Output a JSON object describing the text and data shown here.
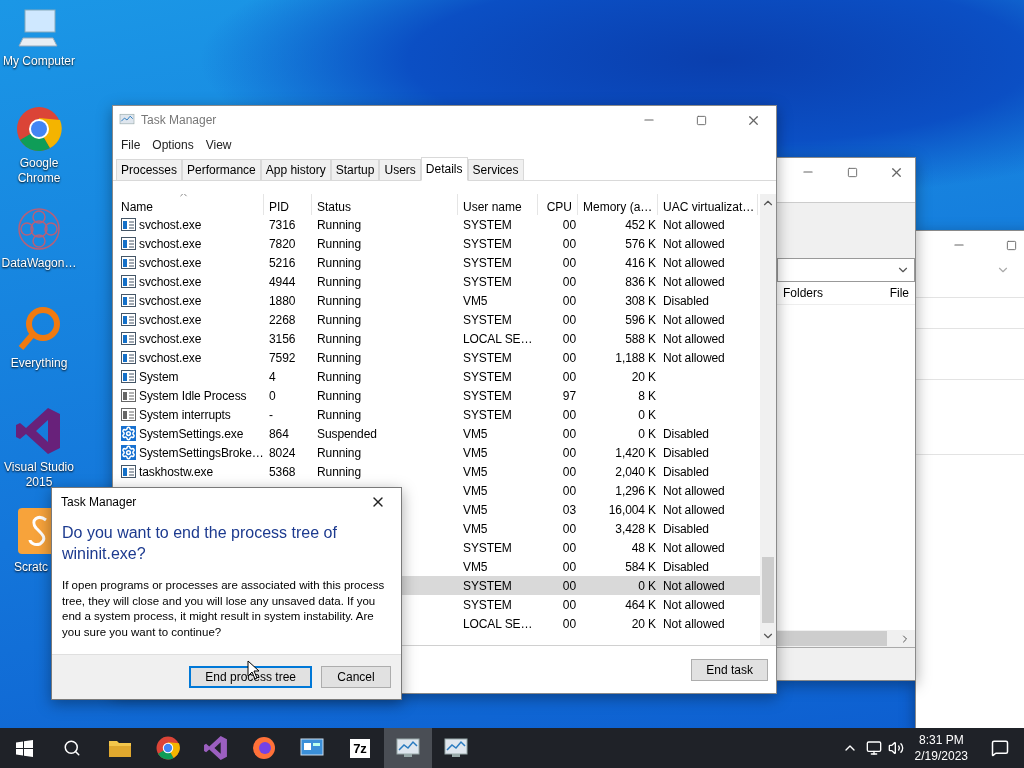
{
  "desktop_icons": [
    {
      "kind": "computer",
      "label": "My Computer"
    },
    {
      "kind": "chrome",
      "label": "Google Chrome"
    },
    {
      "kind": "wagon",
      "label": "DataWagon…"
    },
    {
      "kind": "everything",
      "label": "Everything"
    },
    {
      "kind": "vs",
      "label": "Visual Studio 2015"
    },
    {
      "kind": "scratch",
      "label": "Scratc"
    }
  ],
  "back_window_1": {
    "columns": [
      "Folders",
      "File"
    ]
  },
  "task_manager": {
    "title": "Task Manager",
    "menu": [
      "File",
      "Options",
      "View"
    ],
    "tabs": [
      {
        "label": "Processes",
        "selected": false
      },
      {
        "label": "Performance",
        "selected": false
      },
      {
        "label": "App history",
        "selected": false
      },
      {
        "label": "Startup",
        "selected": false
      },
      {
        "label": "Users",
        "selected": false
      },
      {
        "label": "Details",
        "selected": true
      },
      {
        "label": "Services",
        "selected": false
      }
    ],
    "columns": [
      "Name",
      "PID",
      "Status",
      "User name",
      "CPU",
      "Memory (a…",
      "UAC virtualizat…"
    ],
    "rows": [
      {
        "kind": "service",
        "name": "svchost.exe",
        "pid": "7316",
        "status": "Running",
        "user": "SYSTEM",
        "cpu": "00",
        "memory": "452 K",
        "uac": "Not allowed",
        "selected": false
      },
      {
        "kind": "service",
        "name": "svchost.exe",
        "pid": "7820",
        "status": "Running",
        "user": "SYSTEM",
        "cpu": "00",
        "memory": "576 K",
        "uac": "Not allowed",
        "selected": false
      },
      {
        "kind": "service",
        "name": "svchost.exe",
        "pid": "5216",
        "status": "Running",
        "user": "SYSTEM",
        "cpu": "00",
        "memory": "416 K",
        "uac": "Not allowed",
        "selected": false
      },
      {
        "kind": "service",
        "name": "svchost.exe",
        "pid": "4944",
        "status": "Running",
        "user": "SYSTEM",
        "cpu": "00",
        "memory": "836 K",
        "uac": "Not allowed",
        "selected": false
      },
      {
        "kind": "service",
        "name": "svchost.exe",
        "pid": "1880",
        "status": "Running",
        "user": "VM5",
        "cpu": "00",
        "memory": "308 K",
        "uac": "Disabled",
        "selected": false
      },
      {
        "kind": "service",
        "name": "svchost.exe",
        "pid": "2268",
        "status": "Running",
        "user": "SYSTEM",
        "cpu": "00",
        "memory": "596 K",
        "uac": "Not allowed",
        "selected": false
      },
      {
        "kind": "service",
        "name": "svchost.exe",
        "pid": "3156",
        "status": "Running",
        "user": "LOCAL SE…",
        "cpu": "00",
        "memory": "588 K",
        "uac": "Not allowed",
        "selected": false
      },
      {
        "kind": "service",
        "name": "svchost.exe",
        "pid": "7592",
        "status": "Running",
        "user": "SYSTEM",
        "cpu": "00",
        "memory": "1,188 K",
        "uac": "Not allowed",
        "selected": false
      },
      {
        "kind": "service",
        "name": "System",
        "pid": "4",
        "status": "Running",
        "user": "SYSTEM",
        "cpu": "00",
        "memory": "20 K",
        "selected": false
      },
      {
        "kind": "system",
        "name": "System Idle Process",
        "pid": "0",
        "status": "Running",
        "user": "SYSTEM",
        "cpu": "97",
        "memory": "8 K",
        "selected": false
      },
      {
        "kind": "system",
        "name": "System interrupts",
        "pid": "-",
        "status": "Running",
        "user": "SYSTEM",
        "cpu": "00",
        "memory": "0 K",
        "selected": false
      },
      {
        "kind": "gear",
        "name": "SystemSettings.exe",
        "pid": "864",
        "status": "Suspended",
        "user": "VM5",
        "cpu": "00",
        "memory": "0 K",
        "uac": "Disabled",
        "selected": false
      },
      {
        "kind": "gear",
        "name": "SystemSettingsBroke…",
        "pid": "8024",
        "status": "Running",
        "user": "VM5",
        "cpu": "00",
        "memory": "1,420 K",
        "uac": "Disabled",
        "selected": false
      },
      {
        "kind": "service",
        "name": "taskhostw.exe",
        "pid": "5368",
        "status": "Running",
        "user": "VM5",
        "cpu": "00",
        "memory": "2,040 K",
        "uac": "Disabled",
        "selected": false
      },
      {
        "user": "VM5",
        "cpu": "00",
        "memory": "1,296 K",
        "uac": "Not allowed",
        "selected": false
      },
      {
        "user": "VM5",
        "cpu": "03",
        "memory": "16,004 K",
        "uac": "Not allowed",
        "selected": false
      },
      {
        "user": "VM5",
        "cpu": "00",
        "memory": "3,428 K",
        "uac": "Disabled",
        "selected": false
      },
      {
        "user": "SYSTEM",
        "cpu": "00",
        "memory": "48 K",
        "uac": "Not allowed",
        "selected": false
      },
      {
        "user": "VM5",
        "cpu": "00",
        "memory": "584 K",
        "uac": "Disabled",
        "selected": false
      },
      {
        "user": "SYSTEM",
        "cpu": "00",
        "memory": "0 K",
        "uac": "Not allowed",
        "selected": true
      },
      {
        "user": "SYSTEM",
        "cpu": "00",
        "memory": "464 K",
        "uac": "Not allowed",
        "selected": false
      },
      {
        "user": "LOCAL SE…",
        "cpu": "00",
        "memory": "20 K",
        "uac": "Not allowed",
        "selected": false
      }
    ],
    "end_task_button": "End task"
  },
  "dialog": {
    "title": "Task Manager",
    "heading": "Do you want to end the process tree of wininit.exe?",
    "message": "If open programs or processes are associated with this process tree, they will close and you will lose any unsaved data. If you end a system process, it might result in system instability. Are you sure you want to continue?",
    "buttons": [
      {
        "label": "End process tree",
        "selected": true
      },
      {
        "label": "Cancel",
        "selected": false
      }
    ]
  },
  "taskbar": {
    "apps": [
      {
        "kind": "explorer",
        "selected": false
      },
      {
        "kind": "chrome",
        "selected": false
      },
      {
        "kind": "vs",
        "selected": false
      },
      {
        "kind": "firefox",
        "selected": false
      },
      {
        "kind": "panel",
        "selected": false
      },
      {
        "kind": "archiver",
        "label": "7z",
        "selected": false
      },
      {
        "kind": "taskmgr",
        "selected": true
      },
      {
        "kind": "taskmgr",
        "selected": false
      }
    ],
    "time": "8:31 PM",
    "date": "2/19/2023"
  }
}
